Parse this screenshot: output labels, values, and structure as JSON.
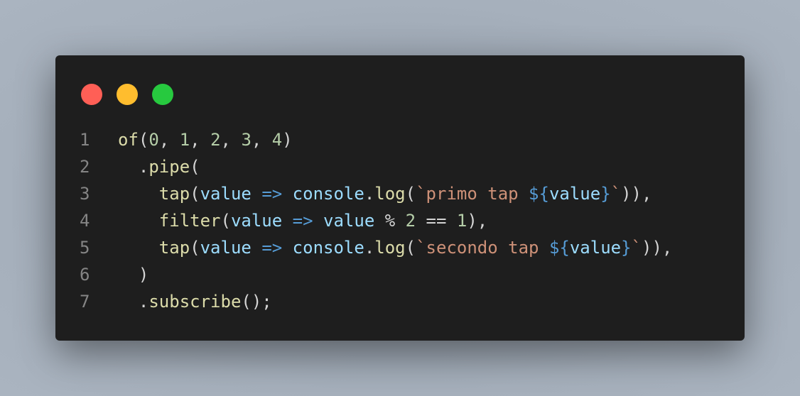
{
  "window": {
    "controls": {
      "close_color": "#ff5f56",
      "minimize_color": "#ffbd2e",
      "maximize_color": "#27c93f"
    }
  },
  "code": {
    "lines": [
      {
        "number": "1",
        "tokens": [
          {
            "t": "of",
            "c": "fn"
          },
          {
            "t": "(",
            "c": "op"
          },
          {
            "t": "0",
            "c": "num"
          },
          {
            "t": ", ",
            "c": "op"
          },
          {
            "t": "1",
            "c": "num"
          },
          {
            "t": ", ",
            "c": "op"
          },
          {
            "t": "2",
            "c": "num"
          },
          {
            "t": ", ",
            "c": "op"
          },
          {
            "t": "3",
            "c": "num"
          },
          {
            "t": ", ",
            "c": "op"
          },
          {
            "t": "4",
            "c": "num"
          },
          {
            "t": ")",
            "c": "op"
          }
        ]
      },
      {
        "number": "2",
        "tokens": [
          {
            "t": "  .",
            "c": "op"
          },
          {
            "t": "pipe",
            "c": "fn"
          },
          {
            "t": "(",
            "c": "op"
          }
        ]
      },
      {
        "number": "3",
        "tokens": [
          {
            "t": "    ",
            "c": "op"
          },
          {
            "t": "tap",
            "c": "fn"
          },
          {
            "t": "(",
            "c": "op"
          },
          {
            "t": "value",
            "c": "var"
          },
          {
            "t": " ",
            "c": "op"
          },
          {
            "t": "=>",
            "c": "kw"
          },
          {
            "t": " ",
            "c": "op"
          },
          {
            "t": "console",
            "c": "var"
          },
          {
            "t": ".",
            "c": "op"
          },
          {
            "t": "log",
            "c": "fn"
          },
          {
            "t": "(",
            "c": "op"
          },
          {
            "t": "`primo tap ",
            "c": "str"
          },
          {
            "t": "${",
            "c": "kw"
          },
          {
            "t": "value",
            "c": "var"
          },
          {
            "t": "}",
            "c": "kw"
          },
          {
            "t": "`",
            "c": "str"
          },
          {
            "t": ")),",
            "c": "op"
          }
        ]
      },
      {
        "number": "4",
        "tokens": [
          {
            "t": "    ",
            "c": "op"
          },
          {
            "t": "filter",
            "c": "fn"
          },
          {
            "t": "(",
            "c": "op"
          },
          {
            "t": "value",
            "c": "var"
          },
          {
            "t": " ",
            "c": "op"
          },
          {
            "t": "=>",
            "c": "kw"
          },
          {
            "t": " ",
            "c": "op"
          },
          {
            "t": "value",
            "c": "var"
          },
          {
            "t": " % ",
            "c": "op"
          },
          {
            "t": "2",
            "c": "num"
          },
          {
            "t": " == ",
            "c": "op"
          },
          {
            "t": "1",
            "c": "num"
          },
          {
            "t": "),",
            "c": "op"
          }
        ]
      },
      {
        "number": "5",
        "tokens": [
          {
            "t": "    ",
            "c": "op"
          },
          {
            "t": "tap",
            "c": "fn"
          },
          {
            "t": "(",
            "c": "op"
          },
          {
            "t": "value",
            "c": "var"
          },
          {
            "t": " ",
            "c": "op"
          },
          {
            "t": "=>",
            "c": "kw"
          },
          {
            "t": " ",
            "c": "op"
          },
          {
            "t": "console",
            "c": "var"
          },
          {
            "t": ".",
            "c": "op"
          },
          {
            "t": "log",
            "c": "fn"
          },
          {
            "t": "(",
            "c": "op"
          },
          {
            "t": "`secondo tap ",
            "c": "str"
          },
          {
            "t": "${",
            "c": "kw"
          },
          {
            "t": "value",
            "c": "var"
          },
          {
            "t": "}",
            "c": "kw"
          },
          {
            "t": "`",
            "c": "str"
          },
          {
            "t": ")),",
            "c": "op"
          }
        ]
      },
      {
        "number": "6",
        "tokens": [
          {
            "t": "  )",
            "c": "op"
          }
        ]
      },
      {
        "number": "7",
        "tokens": [
          {
            "t": "  .",
            "c": "op"
          },
          {
            "t": "subscribe",
            "c": "fn"
          },
          {
            "t": "();",
            "c": "op"
          }
        ]
      }
    ]
  }
}
